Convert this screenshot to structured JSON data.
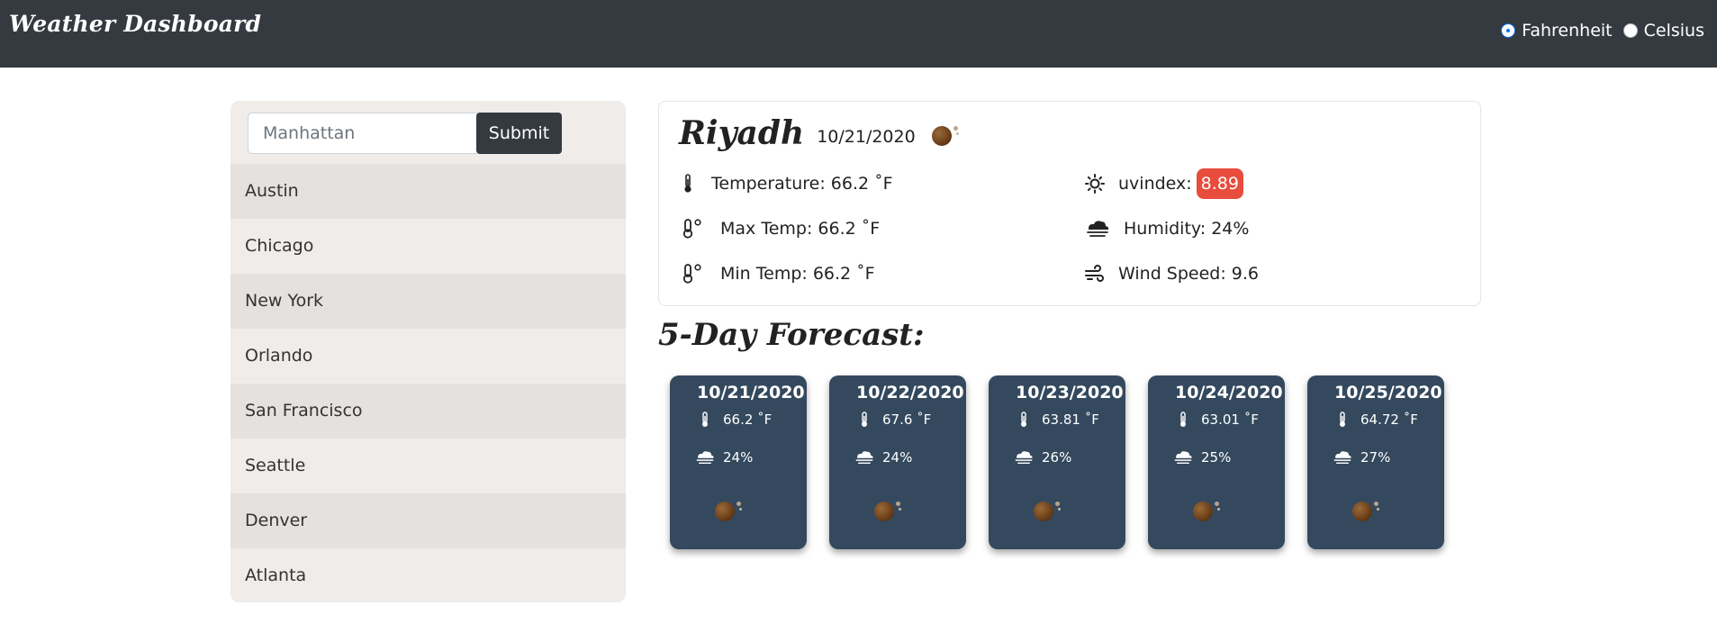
{
  "header": {
    "brand": "Weather Dashboard",
    "units": [
      {
        "label": "Fahrenheit",
        "checked": true
      },
      {
        "label": "Celsius",
        "checked": false
      }
    ]
  },
  "search": {
    "placeholder": "Manhattan",
    "value": "",
    "submit_label": "Submit"
  },
  "cities": [
    "Austin",
    "Chicago",
    "New York",
    "Orlando",
    "San Francisco",
    "Seattle",
    "Denver",
    "Atlanta"
  ],
  "current": {
    "city": "Riyadh",
    "date": "10/21/2020",
    "weather_icon": "weather-icon",
    "temperature": "Temperature: 66.2 ˚F",
    "max_temp": "Max Temp: 66.2 ˚F",
    "min_temp": "Min Temp: 66.2 ˚F",
    "uv_label": "uvindex:",
    "uv_value": "8.89",
    "humidity": "Humidity: 24%",
    "wind": "Wind Speed: 9.6",
    "uv_color": "#e74c3c"
  },
  "forecast": {
    "title": "5-Day Forecast:",
    "days": [
      {
        "date": "10/21/2020",
        "temp": "66.2 ˚F",
        "humidity": "24%"
      },
      {
        "date": "10/22/2020",
        "temp": "67.6 ˚F",
        "humidity": "24%"
      },
      {
        "date": "10/23/2020",
        "temp": "63.81 ˚F",
        "humidity": "26%"
      },
      {
        "date": "10/24/2020",
        "temp": "63.01 ˚F",
        "humidity": "25%"
      },
      {
        "date": "10/25/2020",
        "temp": "64.72 ˚F",
        "humidity": "27%"
      }
    ],
    "card_color": "#34495e"
  },
  "colors": {
    "header_bg": "#343a40",
    "sidebar_bg": "#efecea",
    "accent": "#0d6efd"
  }
}
